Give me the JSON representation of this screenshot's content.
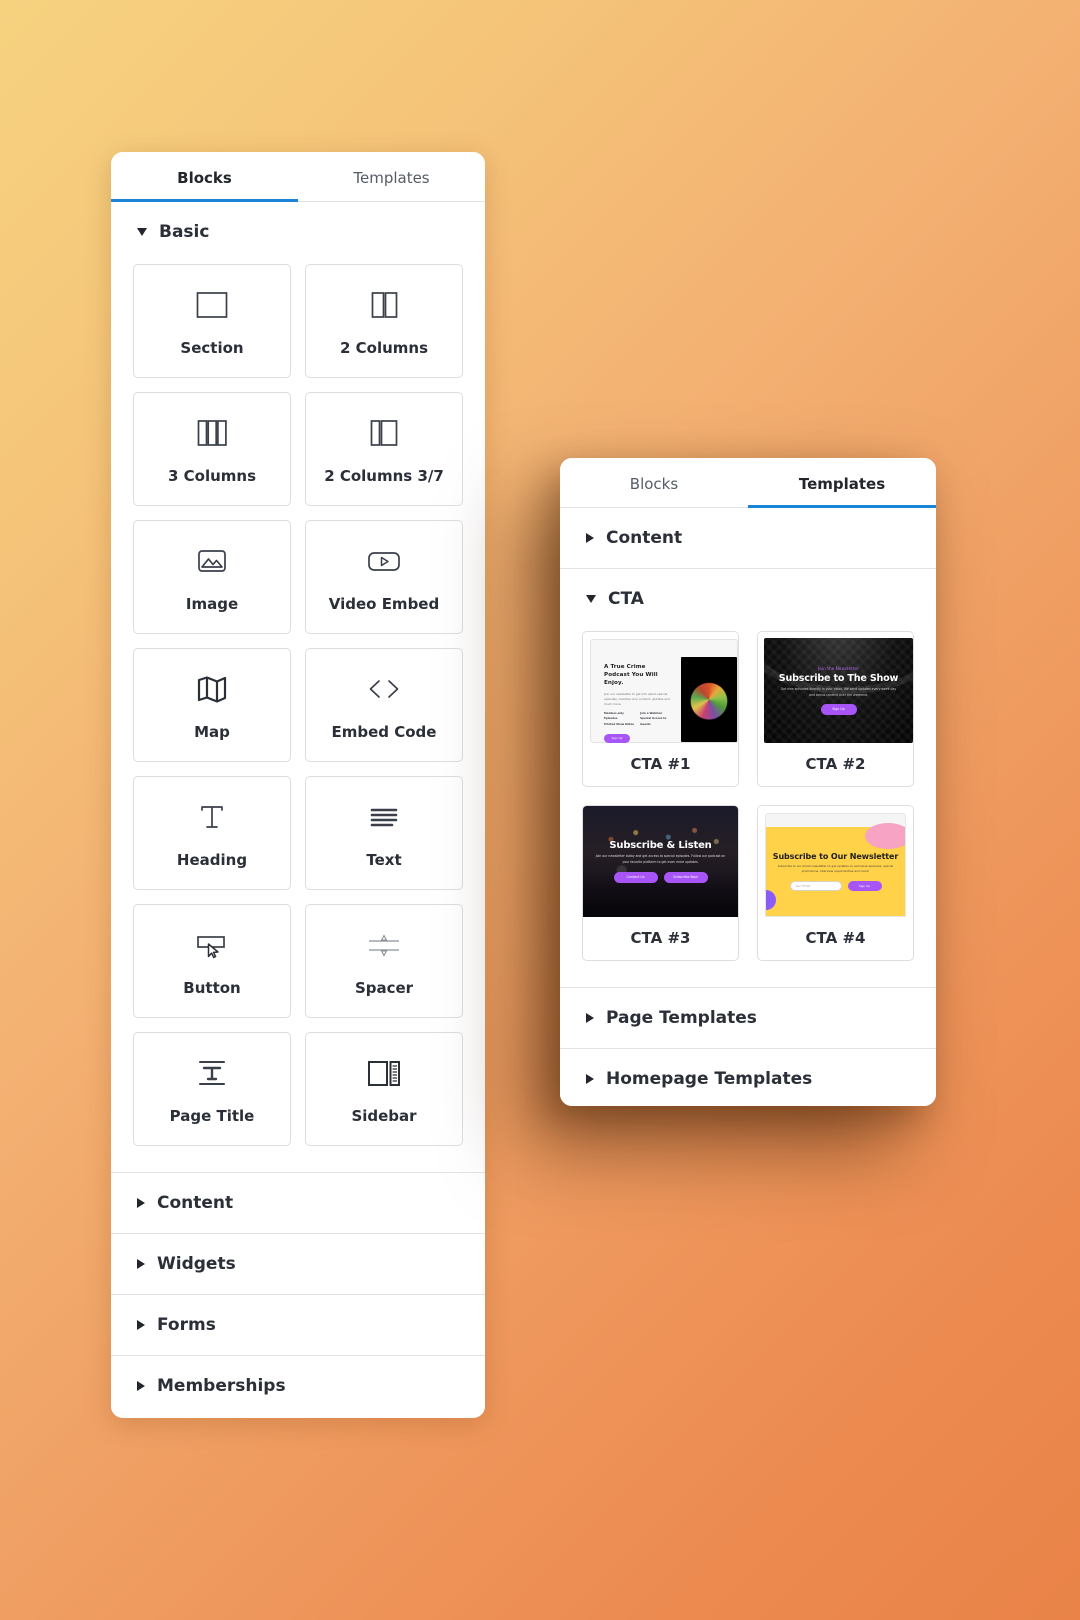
{
  "blocks_panel": {
    "tabs": [
      {
        "label": "Blocks",
        "active": true
      },
      {
        "label": "Templates",
        "active": false
      }
    ],
    "basic_section": {
      "label": "Basic",
      "expanded": true
    },
    "blocks": [
      {
        "label": "Section",
        "icon": "section-icon"
      },
      {
        "label": "2 Columns",
        "icon": "two-columns-icon"
      },
      {
        "label": "3 Columns",
        "icon": "three-columns-icon"
      },
      {
        "label": "2 Columns 3/7",
        "icon": "two-columns-37-icon"
      },
      {
        "label": "Image",
        "icon": "image-icon"
      },
      {
        "label": "Video Embed",
        "icon": "video-embed-icon"
      },
      {
        "label": "Map",
        "icon": "map-icon"
      },
      {
        "label": "Embed Code",
        "icon": "embed-code-icon"
      },
      {
        "label": "Heading",
        "icon": "heading-icon"
      },
      {
        "label": "Text",
        "icon": "text-icon"
      },
      {
        "label": "Button",
        "icon": "button-icon"
      },
      {
        "label": "Spacer",
        "icon": "spacer-icon"
      },
      {
        "label": "Page Title",
        "icon": "page-title-icon"
      },
      {
        "label": "Sidebar",
        "icon": "sidebar-icon"
      }
    ],
    "collapsed_sections": [
      {
        "label": "Content"
      },
      {
        "label": "Widgets"
      },
      {
        "label": "Forms"
      },
      {
        "label": "Memberships"
      }
    ]
  },
  "templates_panel": {
    "tabs": [
      {
        "label": "Blocks",
        "active": false
      },
      {
        "label": "Templates",
        "active": true
      }
    ],
    "content_section": {
      "label": "Content",
      "expanded": false
    },
    "cta_section": {
      "label": "CTA",
      "expanded": true
    },
    "templates": [
      {
        "name": "CTA #1",
        "preview": {
          "heading": "A True Crime Podcast You Will Enjoy.",
          "paragraph": "Join our newsletter to get info about special episodes, member-only content, updates and much more.",
          "bullets": [
            "Member-only Episodes",
            "Printed Show Notes",
            "Join a Webinar",
            "Special Access to Guests"
          ],
          "button": "Sign Up"
        }
      },
      {
        "name": "CTA #2",
        "preview": {
          "eyebrow": "Join the Newsletter",
          "heading": "Subscribe to The Show",
          "paragraph": "Get new episodes directly in your inbox. We send updates every week day and bonus content over the weekend.",
          "button": "Sign Up"
        }
      },
      {
        "name": "CTA #3",
        "preview": {
          "heading": "Subscribe & Listen",
          "paragraph": "Join our newsletter today and get access to special episodes. Follow our podcast on your favorite platform to get even more updates.",
          "buttons": [
            "Contact Us",
            "Subscribe Now"
          ]
        }
      },
      {
        "name": "CTA #4",
        "preview": {
          "heading": "Subscribe to Our Newsletter",
          "paragraph": "Subscribe to our email newsletter to get updates on exclusive episodes, special promotions, interview opportunities and more!",
          "input_placeholder": "Your Email",
          "button": "Sign Up"
        }
      }
    ],
    "collapsed_sections": [
      {
        "label": "Page Templates"
      },
      {
        "label": "Homepage Templates"
      }
    ]
  },
  "colors": {
    "accent": "#1a84d6",
    "purple": "#a855f7",
    "yellow": "#ffd24a",
    "text": "#2b2f38"
  }
}
